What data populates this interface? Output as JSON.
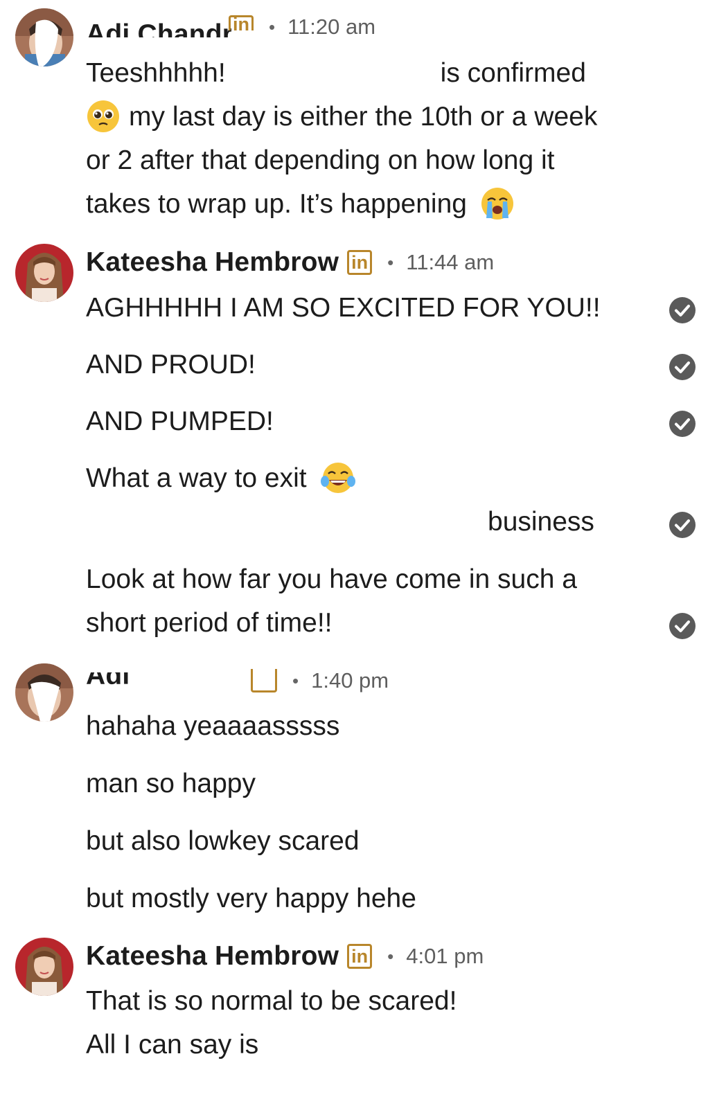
{
  "thread": {
    "groups": [
      {
        "sender": "Adi Chandra",
        "time": "11:20 am",
        "messages": [
          "Teeshhhhh!",
          "is confirmed",
          "my last day is either the 10th or a week",
          "or 2 after that depending on how long it",
          "takes to wrap up. It’s happening"
        ]
      },
      {
        "sender": "Kateesha Hembrow",
        "time": "11:44 am",
        "messages": [
          "AGHHHHH I AM SO EXCITED FOR YOU!!",
          "AND PROUD!",
          "AND PUMPED!",
          "What a way to exit",
          "business",
          "Look at how far you have come in such a",
          "short period of time!!"
        ]
      },
      {
        "sender": "Adi",
        "time": "1:40 pm",
        "messages": [
          "hahaha yeaaaasssss",
          "man so happy",
          "but also lowkey scared",
          "but mostly very happy hehe"
        ]
      },
      {
        "sender": "Kateesha Hembrow",
        "time": "4:01 pm",
        "messages": [
          "That is so normal to be scared!",
          "All I can say is"
        ]
      }
    ],
    "badge_text": "in",
    "separator": "•"
  },
  "icons": {
    "read_receipt": "check-circle-icon",
    "linkedin_badge": "linkedin-icon",
    "pleading": "pleading-face-emoji",
    "crying": "loudly-crying-face-emoji",
    "laughing": "tears-of-joy-emoji"
  },
  "colors": {
    "badge": "#b8862b",
    "check": "#5a5a5a",
    "text": "#1c1c1c",
    "time": "#5e5e5e"
  }
}
